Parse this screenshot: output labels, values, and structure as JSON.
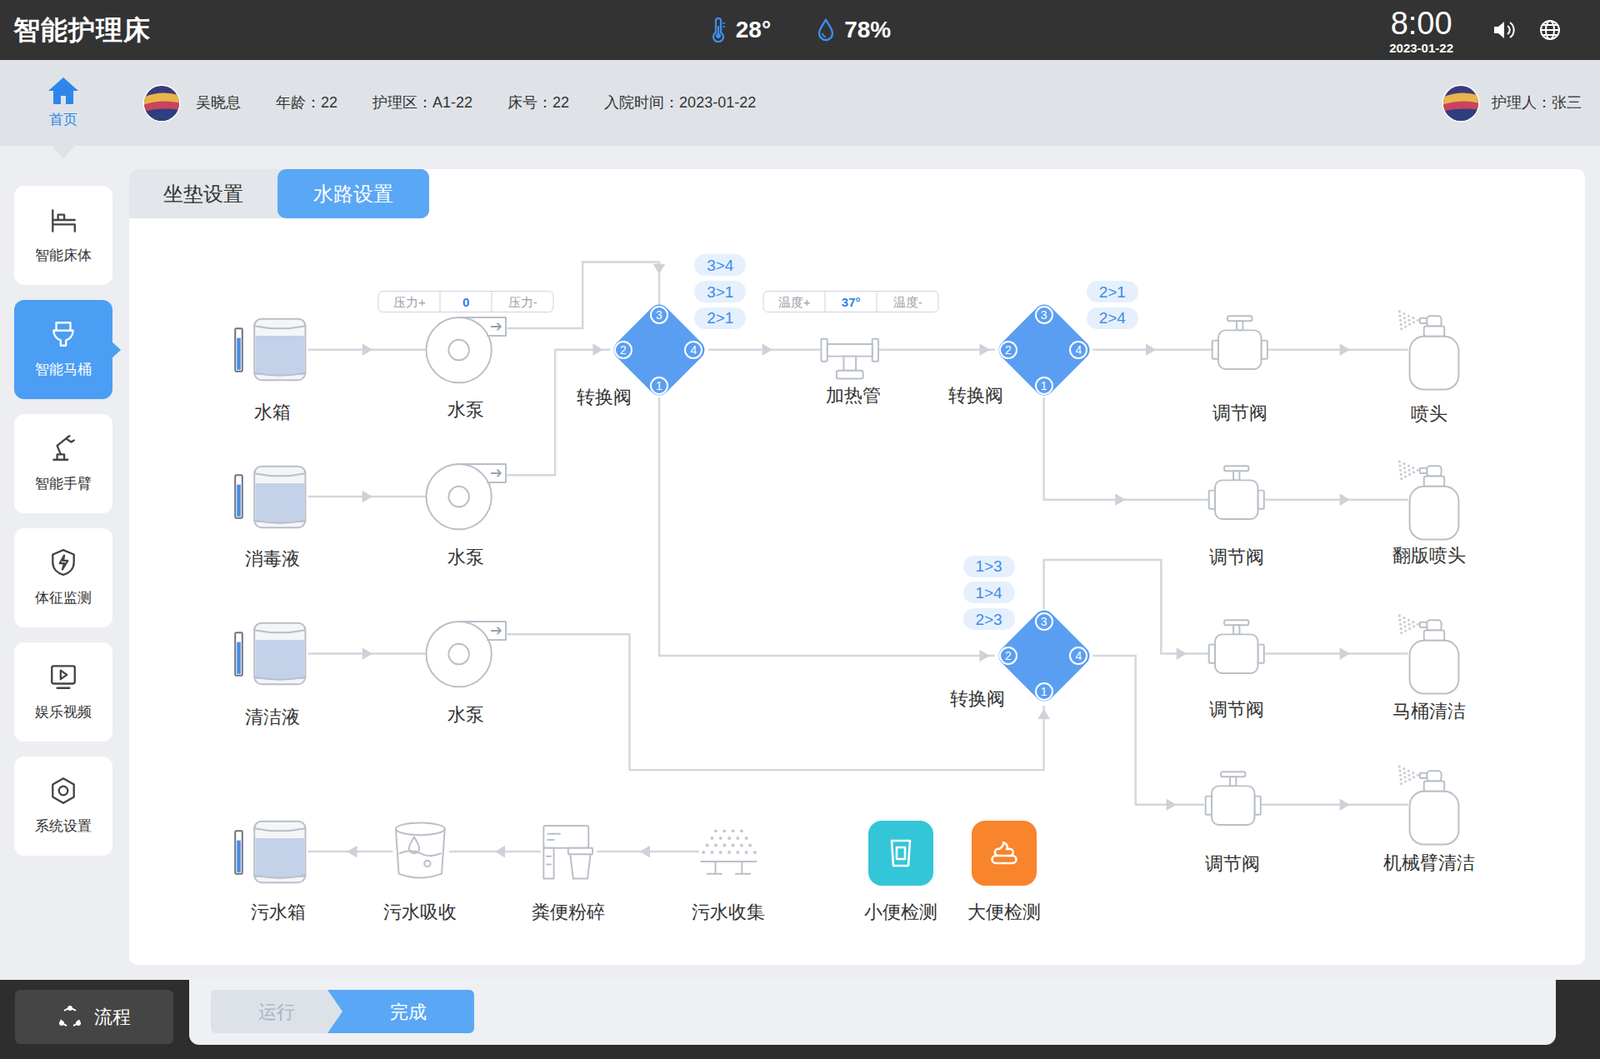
{
  "header": {
    "title": "智能护理床",
    "temperature": "28°",
    "humidity": "78%",
    "time": "8:00",
    "date": "2023-01-22"
  },
  "home": {
    "label": "首页",
    "selected": true
  },
  "patient": {
    "name": "吴晓息",
    "fields": [
      "年龄：22",
      "护理区：A1-22",
      "床号：22",
      "入院时间：2023-01-22"
    ]
  },
  "caregiver": {
    "label": "护理人：张三"
  },
  "sidebar": {
    "items": [
      {
        "label": "智能床体",
        "selected": false
      },
      {
        "label": "智能马桶",
        "selected": true
      },
      {
        "label": "智能手臂",
        "selected": false
      },
      {
        "label": "体征监测",
        "selected": false
      },
      {
        "label": "娱乐视频",
        "selected": false
      },
      {
        "label": "系统设置",
        "selected": false
      }
    ]
  },
  "tabs": [
    {
      "label": "坐垫设置",
      "selected": false
    },
    {
      "label": "水路设置",
      "selected": true
    }
  ],
  "diagram": {
    "supplies": [
      {
        "tank": "水箱",
        "pump": "水泵",
        "level": 0.8
      },
      {
        "tank": "消毒液",
        "pump": "水泵",
        "level": 0.8
      },
      {
        "tank": "清洁液",
        "pump": "水泵",
        "level": 0.8
      }
    ],
    "pressure": {
      "plus": "压力+",
      "value": "0",
      "minus": "压力-"
    },
    "heater": {
      "label": "加热管"
    },
    "temperature": {
      "plus": "温度+",
      "value": "37°",
      "minus": "温度-"
    },
    "valves": [
      {
        "label": "转换阀",
        "ports": [
          "1",
          "2",
          "3",
          "4"
        ],
        "options": [
          "3>4",
          "3>1",
          "2>1"
        ]
      },
      {
        "label": "转换阀",
        "ports": [
          "1",
          "2",
          "3",
          "4"
        ],
        "options": [
          "2>1",
          "2>4"
        ]
      },
      {
        "label": "转换阀",
        "ports": [
          "1",
          "2",
          "3",
          "4"
        ],
        "options": [
          "1>3",
          "1>4",
          "2>3"
        ]
      }
    ],
    "outputs": [
      {
        "regulator": "调节阀",
        "outlet": "喷头"
      },
      {
        "regulator": "调节阀",
        "outlet": "翻版喷头"
      },
      {
        "regulator": "调节阀",
        "outlet": "马桶清洁"
      },
      {
        "regulator": "调节阀",
        "outlet": "机械臂清洁"
      }
    ],
    "waste": [
      {
        "label": "污水箱",
        "kind": "tank",
        "level": 0.8
      },
      {
        "label": "污水吸收",
        "kind": "absorb"
      },
      {
        "label": "粪便粉碎",
        "kind": "crush"
      },
      {
        "label": "污水收集",
        "kind": "collect"
      }
    ],
    "detections": [
      {
        "label": "小便检测",
        "color": "#33c6d9"
      },
      {
        "label": "大便检测",
        "color": "#f8842c"
      }
    ]
  },
  "footer": {
    "flow": "流程",
    "steps": [
      {
        "label": "运行",
        "selected": false
      },
      {
        "label": "完成",
        "selected": true
      }
    ]
  }
}
